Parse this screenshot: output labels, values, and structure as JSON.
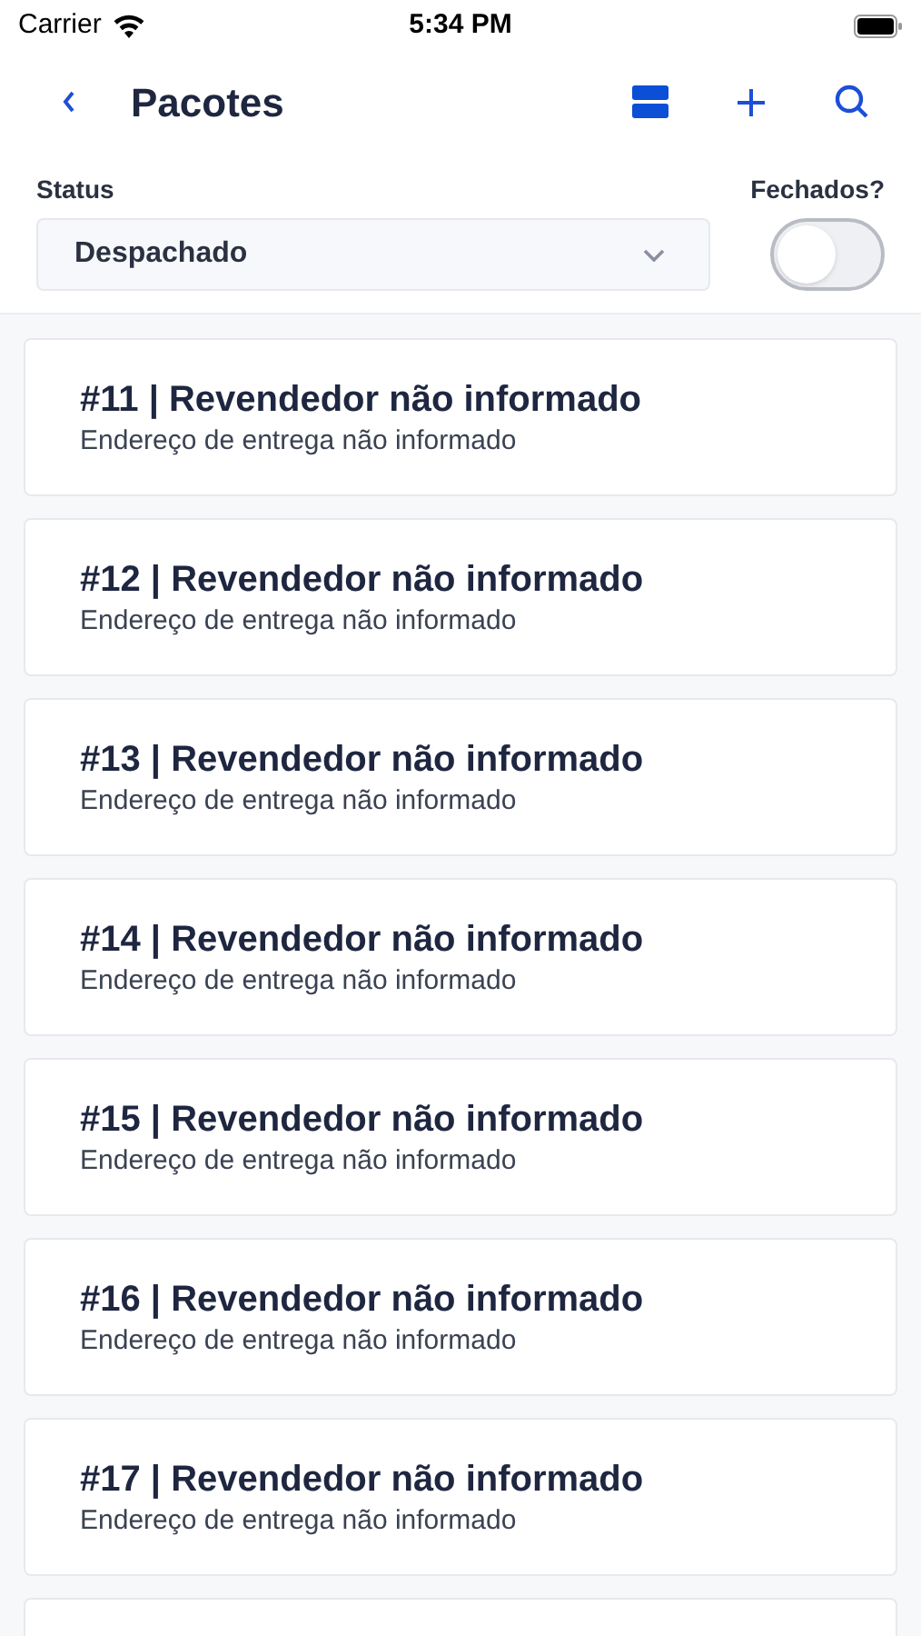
{
  "status_bar": {
    "carrier": "Carrier",
    "time": "5:34 PM"
  },
  "nav": {
    "title": "Pacotes"
  },
  "filters": {
    "status_label": "Status",
    "status_value": "Despachado",
    "closed_label": "Fechados?",
    "closed_on": false
  },
  "packages": [
    {
      "title": "#11 | Revendedor não informado",
      "subtitle": "Endereço de entrega não informado"
    },
    {
      "title": "#12 | Revendedor não informado",
      "subtitle": "Endereço de entrega não informado"
    },
    {
      "title": "#13 | Revendedor não informado",
      "subtitle": "Endereço de entrega não informado"
    },
    {
      "title": "#14 | Revendedor não informado",
      "subtitle": "Endereço de entrega não informado"
    },
    {
      "title": "#15 | Revendedor não informado",
      "subtitle": "Endereço de entrega não informado"
    },
    {
      "title": "#16 | Revendedor não informado",
      "subtitle": "Endereço de entrega não informado"
    },
    {
      "title": "#17 | Revendedor não informado",
      "subtitle": "Endereço de entrega não informado"
    }
  ]
}
